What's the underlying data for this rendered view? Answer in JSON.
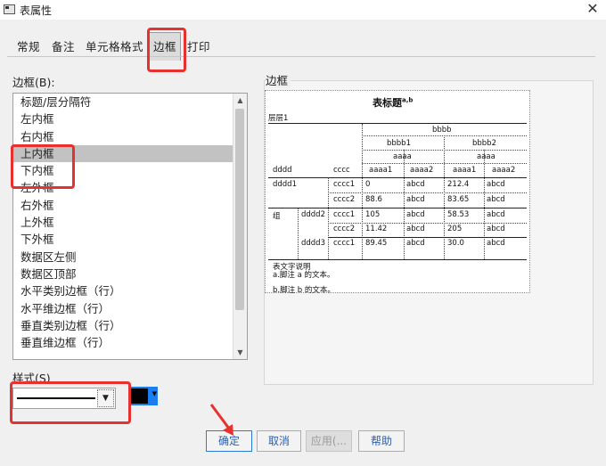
{
  "window": {
    "title": "表属性"
  },
  "tabs": [
    {
      "label": "常规"
    },
    {
      "label": "备注"
    },
    {
      "label": "单元格格式"
    },
    {
      "label": "边框"
    },
    {
      "label": "打印"
    }
  ],
  "border_list": {
    "label": "边框(B):",
    "items": [
      "标题/层分隔符",
      "左内框",
      "右内框",
      "上内框",
      "下内框",
      "左外框",
      "右外框",
      "上外框",
      "下外框",
      "数据区左侧",
      "数据区顶部",
      "水平类别边框（行）",
      "水平维边框（行）",
      "垂直类别边框（行）",
      "垂直维边框（行）"
    ],
    "selected_index": 3
  },
  "style": {
    "label": "样式(S)"
  },
  "color": {
    "current": "#000000",
    "frame": "#1a7ef0"
  },
  "preview": {
    "label": "边框",
    "title": "表标题",
    "title_sup": "a,b",
    "layer": "层层1",
    "bbbb": "bbbb",
    "bbbb1": "bbbb1",
    "bbbb2": "bbbb2",
    "aaaa_a": "aaaa",
    "aaaa_b": "aaaa",
    "dddd": "dddd",
    "cccc": "cccc",
    "col_aaaa1_a": "aaaa1",
    "col_aaaa2_a": "aaaa2",
    "col_aaaa1_b": "aaaa1",
    "col_aaaa2_b": "aaaa2",
    "rows": [
      {
        "d": "dddd1",
        "c": "cccc1",
        "v1": "0",
        "v2": "abcd",
        "v3": "212.4",
        "v4": "abcd"
      },
      {
        "d": "",
        "c": "cccc2",
        "v1": "88.6",
        "v2": "abcd",
        "v3": "83.65",
        "v4": "abcd"
      },
      {
        "d": "dddd2",
        "c": "cccc1",
        "v1": "105",
        "v2": "abcd",
        "v3": "58.53",
        "v4": "abcd"
      },
      {
        "d": "",
        "c": "cccc2",
        "v1": "11.42",
        "v2": "abcd",
        "v3": "205",
        "v4": "abcd"
      },
      {
        "d": "dddd3",
        "c": "cccc1",
        "v1": "89.45",
        "v2": "abcd",
        "v3": "30.0",
        "v4": "abcd"
      }
    ],
    "group": "组",
    "caption": "表文字说明",
    "footnote_a": "a.脚注 a 的文本。",
    "footnote_b": "b.脚注 b 的文本。"
  },
  "buttons": {
    "ok": "确定",
    "cancel": "取消",
    "apply": "应用(",
    "apply_suffix": "...",
    "help": "帮助"
  },
  "annotations": {
    "highlight_color": "#e8312f"
  }
}
